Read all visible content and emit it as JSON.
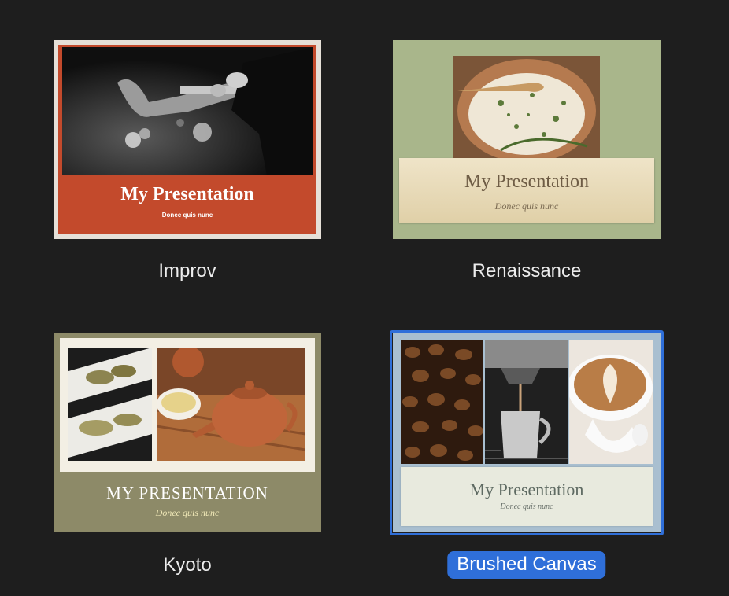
{
  "themes": [
    {
      "name": "Improv",
      "title": "My Presentation",
      "subtitle": "Donec quis nunc",
      "selected": false
    },
    {
      "name": "Renaissance",
      "title": "My Presentation",
      "subtitle": "Donec quis nunc",
      "selected": false
    },
    {
      "name": "Kyoto",
      "title": "MY PRESENTATION",
      "subtitle": "Donec quis nunc",
      "selected": false
    },
    {
      "name": "Brushed Canvas",
      "title": "My Presentation",
      "subtitle": "Donec quis nunc",
      "selected": true
    }
  ],
  "colors": {
    "background": "#1e1e1e",
    "selection": "#2f6fd9",
    "improv_red": "#c34a2c",
    "renaissance_green": "#a9b68b",
    "kyoto_olive": "#8d8a68",
    "canvas_blue": "#a9bfd0"
  }
}
